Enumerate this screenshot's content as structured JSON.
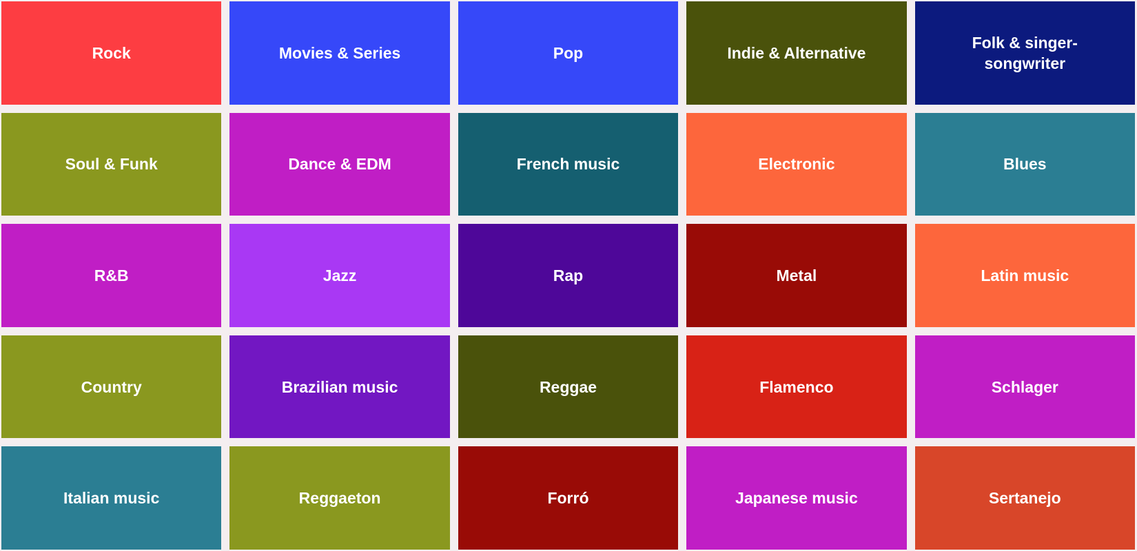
{
  "genres": [
    {
      "label": "Rock",
      "color": "#fd3d42"
    },
    {
      "label": "Movies & Series",
      "color": "#3648f9"
    },
    {
      "label": "Pop",
      "color": "#3648f9"
    },
    {
      "label": "Indie & Alternative",
      "color": "#4a520b"
    },
    {
      "label": "Folk & singer-songwriter",
      "color": "#0c1a7e"
    },
    {
      "label": "Soul & Funk",
      "color": "#8a981f"
    },
    {
      "label": "Dance & EDM",
      "color": "#c01ec5"
    },
    {
      "label": "French music",
      "color": "#155f70"
    },
    {
      "label": "Electronic",
      "color": "#fd663c"
    },
    {
      "label": "Blues",
      "color": "#2b7e93"
    },
    {
      "label": "R&B",
      "color": "#c01ec5"
    },
    {
      "label": "Jazz",
      "color": "#a938f4"
    },
    {
      "label": "Rap",
      "color": "#4e0799"
    },
    {
      "label": "Metal",
      "color": "#990b06"
    },
    {
      "label": "Latin music",
      "color": "#fd663c"
    },
    {
      "label": "Country",
      "color": "#8a981f"
    },
    {
      "label": "Brazilian music",
      "color": "#7217c2"
    },
    {
      "label": "Reggae",
      "color": "#4a520b"
    },
    {
      "label": "Flamenco",
      "color": "#d82216"
    },
    {
      "label": "Schlager",
      "color": "#c01ec5"
    },
    {
      "label": "Italian music",
      "color": "#2b7e93"
    },
    {
      "label": "Reggaeton",
      "color": "#8a981f"
    },
    {
      "label": "Forró",
      "color": "#990b06"
    },
    {
      "label": "Japanese music",
      "color": "#c01ec5"
    },
    {
      "label": "Sertanejo",
      "color": "#d84629"
    }
  ]
}
